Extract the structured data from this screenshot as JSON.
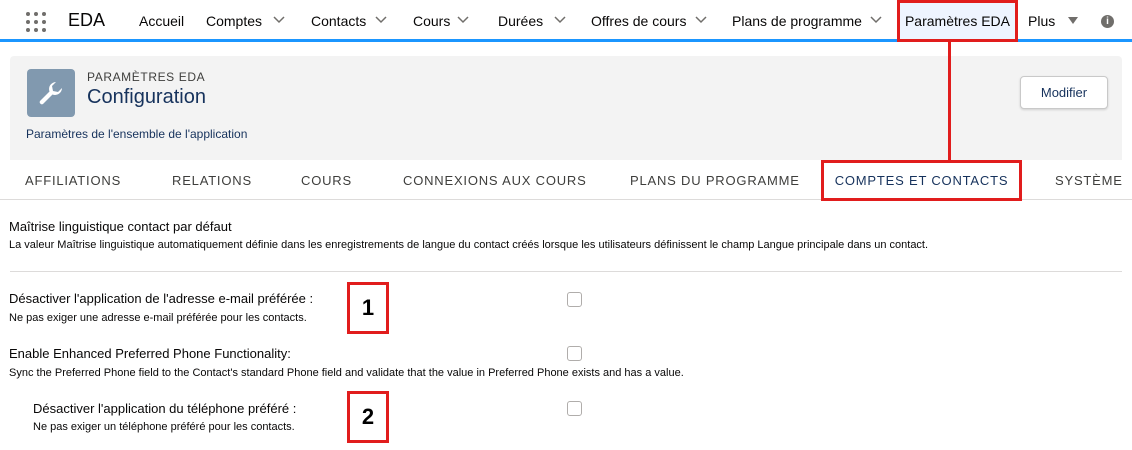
{
  "app": {
    "name": "EDA"
  },
  "nav": {
    "items": [
      {
        "label": "Accueil"
      },
      {
        "label": "Comptes"
      },
      {
        "label": "Contacts"
      },
      {
        "label": "Cours"
      },
      {
        "label": "Durées"
      },
      {
        "label": "Offres de cours"
      },
      {
        "label": "Plans de programme"
      },
      {
        "label": "Paramètres EDA"
      },
      {
        "label": "Plus"
      }
    ]
  },
  "header": {
    "object_label": "PARAMÈTRES EDA",
    "title": "Configuration",
    "description": "Paramètres de l'ensemble de l'application",
    "modify_label": "Modifier"
  },
  "tabs": [
    {
      "label": "AFFILIATIONS"
    },
    {
      "label": "RELATIONS"
    },
    {
      "label": "COURS"
    },
    {
      "label": "CONNEXIONS AUX COURS"
    },
    {
      "label": "PLANS DU PROGRAMME"
    },
    {
      "label": "COMPTES ET CONTACTS"
    },
    {
      "label": "SYSTÈME"
    }
  ],
  "settings": [
    {
      "label": "Maîtrise linguistique contact par défaut",
      "help": "La valeur Maîtrise linguistique automatiquement définie dans les enregistrements de langue du contact créés lorsque les utilisateurs définissent le champ Langue principale dans un contact."
    },
    {
      "label": "Désactiver l'application de l'adresse e-mail préférée :",
      "help": "Ne pas exiger une adresse e-mail préférée pour les contacts.",
      "checked": false
    },
    {
      "label": "Enable Enhanced Preferred Phone Functionality:",
      "help": "Sync the Preferred Phone field to the Contact's standard Phone field and validate that the value in Preferred Phone exists and has a value.",
      "checked": false
    },
    {
      "label": "Désactiver l'application du téléphone préféré :",
      "help": "Ne pas exiger un téléphone préféré pour les contacts.",
      "checked": false
    }
  ],
  "annotations": [
    {
      "label": "1"
    },
    {
      "label": "2"
    }
  ],
  "colors": {
    "highlight": "#e11d1d",
    "nav_accent": "#1b96ff",
    "icon_bg": "#8199af"
  }
}
